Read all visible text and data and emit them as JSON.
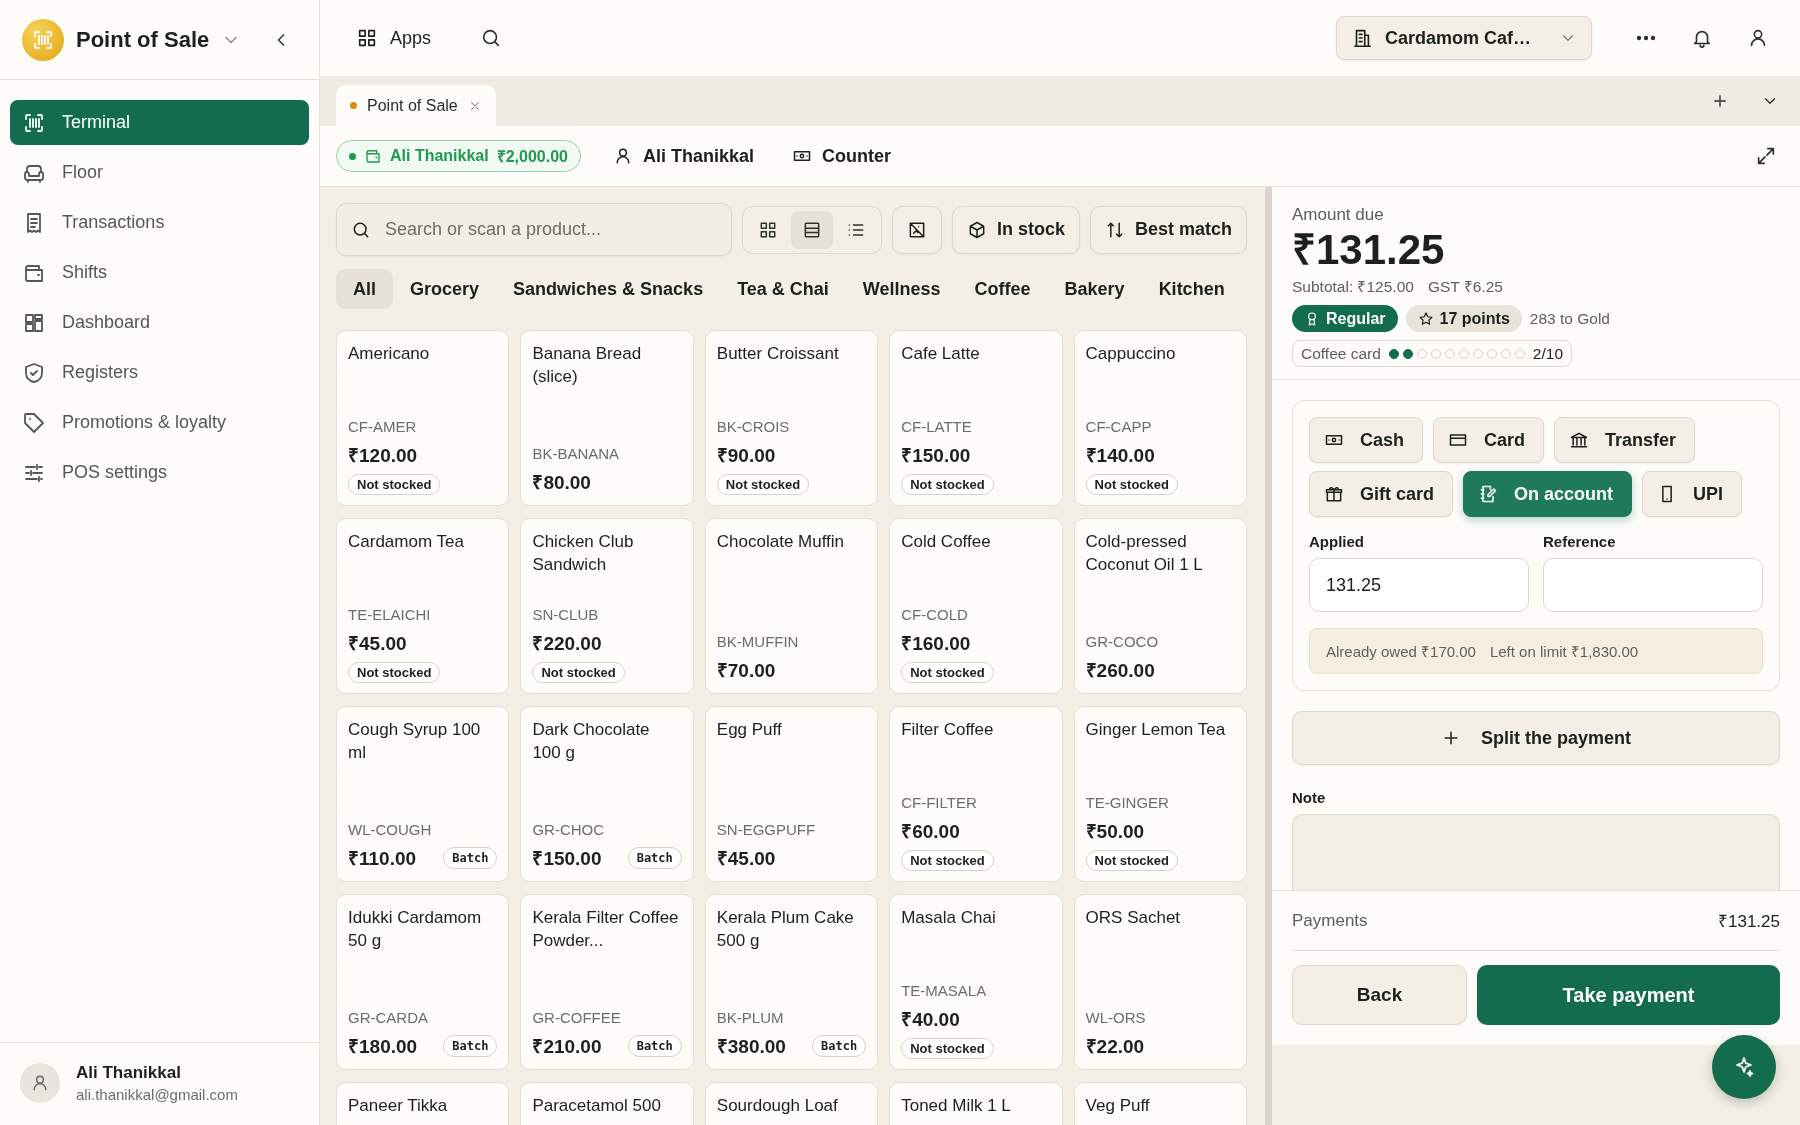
{
  "sidebar": {
    "app_name": "Point of Sale",
    "items": [
      {
        "kind": "terminal",
        "label": "Terminal",
        "selected": true
      },
      {
        "kind": "floor",
        "label": "Floor",
        "selected": false
      },
      {
        "kind": "transactions",
        "label": "Transactions",
        "selected": false
      },
      {
        "kind": "shifts",
        "label": "Shifts",
        "selected": false
      },
      {
        "kind": "dashboard",
        "label": "Dashboard",
        "selected": false
      },
      {
        "kind": "registers",
        "label": "Registers",
        "selected": false
      },
      {
        "kind": "promotions",
        "label": "Promotions & loyalty",
        "selected": false
      },
      {
        "kind": "settings",
        "label": "POS settings",
        "selected": false
      }
    ],
    "user": {
      "name": "Ali Thanikkal",
      "email": "ali.thanikkal@gmail.com"
    }
  },
  "topbar": {
    "apps_label": "Apps",
    "store": "Cardamom Caf…"
  },
  "tabs": [
    {
      "label": "Point of Sale",
      "unsaved": true,
      "selected": true
    }
  ],
  "customer_bar": {
    "account_chip": {
      "name": "Ali Thanikkal",
      "balance": "₹2,000.00"
    },
    "customer": "Ali Thanikkal",
    "register": "Counter"
  },
  "products": {
    "search": {
      "placeholder": "Search or scan a product..."
    },
    "view_modes": [
      {
        "kind": "grid",
        "selected": false
      },
      {
        "kind": "cards",
        "selected": true
      },
      {
        "kind": "list",
        "selected": false
      }
    ],
    "filters": [
      {
        "kind": "stock",
        "label": "In stock"
      },
      {
        "kind": "sort",
        "label": "Best match"
      }
    ],
    "categories": [
      {
        "label": "All",
        "selected": true
      },
      {
        "label": "Grocery",
        "selected": false
      },
      {
        "label": "Sandwiches & Snacks",
        "selected": false
      },
      {
        "label": "Tea & Chai",
        "selected": false
      },
      {
        "label": "Wellness",
        "selected": false
      },
      {
        "label": "Coffee",
        "selected": false
      },
      {
        "label": "Bakery",
        "selected": false
      },
      {
        "label": "Kitchen",
        "selected": false
      }
    ],
    "items": [
      {
        "name": "Americano",
        "sku": "CF-AMER",
        "price": "₹120.00",
        "badge": {
          "kind": "stock",
          "label": "Not stocked"
        }
      },
      {
        "name": "Banana Bread (slice)",
        "sku": "BK-BANANA",
        "price": "₹80.00"
      },
      {
        "name": "Butter Croissant",
        "sku": "BK-CROIS",
        "price": "₹90.00",
        "badge": {
          "kind": "stock",
          "label": "Not stocked"
        }
      },
      {
        "name": "Cafe Latte",
        "sku": "CF-LATTE",
        "price": "₹150.00",
        "badge": {
          "kind": "stock",
          "label": "Not stocked"
        }
      },
      {
        "name": "Cappuccino",
        "sku": "CF-CAPP",
        "price": "₹140.00",
        "badge": {
          "kind": "stock",
          "label": "Not stocked"
        }
      },
      {
        "name": "Cardamom Tea",
        "sku": "TE-ELAICHI",
        "price": "₹45.00",
        "badge": {
          "kind": "stock",
          "label": "Not stocked"
        }
      },
      {
        "name": "Chicken Club Sandwich",
        "sku": "SN-CLUB",
        "price": "₹220.00",
        "badge": {
          "kind": "stock",
          "label": "Not stocked"
        }
      },
      {
        "name": "Chocolate Muffin",
        "sku": "BK-MUFFIN",
        "price": "₹70.00"
      },
      {
        "name": "Cold Coffee",
        "sku": "CF-COLD",
        "price": "₹160.00",
        "badge": {
          "kind": "stock",
          "label": "Not stocked"
        }
      },
      {
        "name": "Cold-pressed Coconut Oil 1 L",
        "sku": "GR-COCO",
        "price": "₹260.00"
      },
      {
        "name": "Cough Syrup 100 ml",
        "sku": "WL-COUGH",
        "price": "₹110.00",
        "badge": {
          "kind": "batch",
          "label": "Batch"
        }
      },
      {
        "name": "Dark Chocolate 100 g",
        "sku": "GR-CHOC",
        "price": "₹150.00",
        "badge": {
          "kind": "batch",
          "label": "Batch"
        }
      },
      {
        "name": "Egg Puff",
        "sku": "SN-EGGPUFF",
        "price": "₹45.00"
      },
      {
        "name": "Filter Coffee",
        "sku": "CF-FILTER",
        "price": "₹60.00",
        "badge": {
          "kind": "stock",
          "label": "Not stocked"
        }
      },
      {
        "name": "Ginger Lemon Tea",
        "sku": "TE-GINGER",
        "price": "₹50.00",
        "badge": {
          "kind": "stock",
          "label": "Not stocked"
        }
      },
      {
        "name": "Idukki Cardamom 50 g",
        "sku": "GR-CARDA",
        "price": "₹180.00",
        "badge": {
          "kind": "batch",
          "label": "Batch"
        }
      },
      {
        "name": "Kerala Filter Coffee Powder...",
        "sku": "GR-COFFEE",
        "price": "₹210.00",
        "badge": {
          "kind": "batch",
          "label": "Batch"
        }
      },
      {
        "name": "Kerala Plum Cake 500 g",
        "sku": "BK-PLUM",
        "price": "₹380.00",
        "badge": {
          "kind": "batch",
          "label": "Batch"
        }
      },
      {
        "name": "Masala Chai",
        "sku": "TE-MASALA",
        "price": "₹40.00",
        "badge": {
          "kind": "stock",
          "label": "Not stocked"
        }
      },
      {
        "name": "ORS Sachet",
        "sku": "WL-ORS",
        "price": "₹22.00"
      },
      {
        "name": "Paneer Tikka"
      },
      {
        "name": "Paracetamol 500"
      },
      {
        "name": "Sourdough Loaf"
      },
      {
        "name": "Toned Milk 1 L"
      },
      {
        "name": "Veg Puff"
      }
    ]
  },
  "payment": {
    "amount_label": "Amount due",
    "amount": "₹131.25",
    "subtotal": "Subtotal: ₹125.00",
    "tax": "GST ₹6.25",
    "tier": "Regular",
    "points": "17 points",
    "next_tier": "283 to Gold",
    "coffee_card": {
      "label": "Coffee card",
      "stamps": [
        {
          "filled": true
        },
        {
          "filled": true
        },
        {
          "filled": false
        },
        {
          "filled": false
        },
        {
          "filled": false
        },
        {
          "filled": false
        },
        {
          "filled": false
        },
        {
          "filled": false
        },
        {
          "filled": false
        },
        {
          "filled": false
        }
      ],
      "count": "2/10"
    },
    "methods": [
      {
        "kind": "cash",
        "label": "Cash",
        "selected": false
      },
      {
        "kind": "card",
        "label": "Card",
        "selected": false
      },
      {
        "kind": "transfer",
        "label": "Transfer",
        "selected": false
      },
      {
        "kind": "gift",
        "label": "Gift card",
        "selected": false
      },
      {
        "kind": "account",
        "label": "On account",
        "selected": true
      },
      {
        "kind": "upi",
        "label": "UPI",
        "selected": false
      }
    ],
    "applied": {
      "label": "Applied",
      "value": "131.25"
    },
    "reference": {
      "label": "Reference"
    },
    "account_info": [
      "Already owed ₹170.00",
      "Left on limit ₹1,830.00"
    ],
    "split_label": "Split the payment",
    "note_label": "Note",
    "payments_label": "Payments",
    "payments_total": "₹131.25",
    "back": "Back",
    "take": "Take payment"
  }
}
